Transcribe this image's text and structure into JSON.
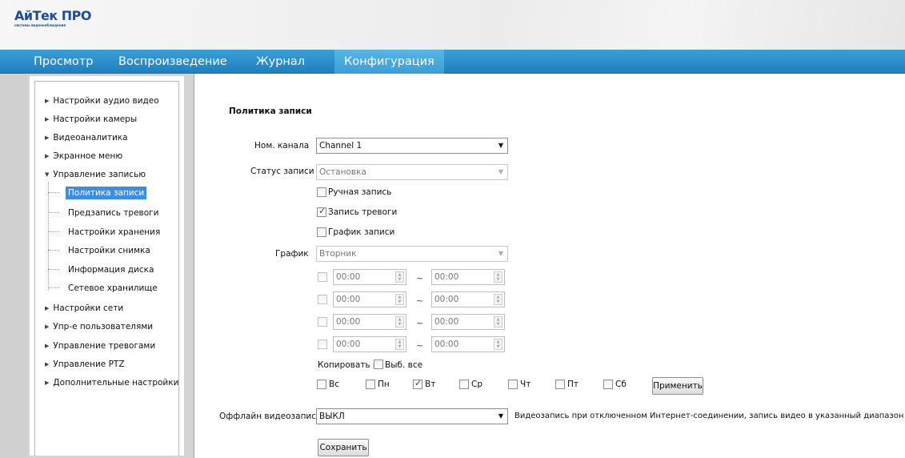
{
  "header": {
    "logo_main": "АйТек ПРО",
    "logo_sub": "системы видеонаблюдения"
  },
  "nav": {
    "tabs": [
      "Просмотр",
      "Воспроизведение",
      "Журнал",
      "Конфигурация"
    ],
    "active": "Конфигурация"
  },
  "sidebar": {
    "top_items": [
      "Настройки аудио видео",
      "Настройки камеры",
      "Видеоаналитика",
      "Экранное меню"
    ],
    "expanded_item": "Управление записью",
    "sub_items": [
      "Политика записи",
      "Предзапись тревоги",
      "Настройки хранения",
      "Настройки снимка",
      "Информация диска",
      "Сетевое хранилище"
    ],
    "active_sub": "Политика записи",
    "bottom_items": [
      "Настройки сети",
      "Упр-е пользователями",
      "Управление тревогами",
      "Управление PTZ",
      "Дополнительные настройки"
    ]
  },
  "form": {
    "title": "Политика записи",
    "channel_label": "Ном. канала",
    "channel_value": "Channel 1",
    "status_label": "Статус записи",
    "status_value": "Остановка",
    "manual_record": {
      "label": "Ручная запись",
      "checked": false
    },
    "alarm_record": {
      "label": "Запись тревоги",
      "checked": true
    },
    "schedule_record": {
      "label": "График записи",
      "checked": false
    },
    "schedule_label": "График",
    "schedule_day": "Вторник",
    "time_ranges": [
      {
        "start": "00:00",
        "end": "00:00"
      },
      {
        "start": "00:00",
        "end": "00:00"
      },
      {
        "start": "00:00",
        "end": "00:00"
      },
      {
        "start": "00:00",
        "end": "00:00"
      }
    ],
    "tilde": "~",
    "copy_label": "Копировать в",
    "select_all_label": "Выб. все",
    "days": [
      {
        "label": "Вс",
        "checked": false
      },
      {
        "label": "Пн",
        "checked": false
      },
      {
        "label": "Вт",
        "checked": true
      },
      {
        "label": "Ср",
        "checked": false
      },
      {
        "label": "Чт",
        "checked": false
      },
      {
        "label": "Пт",
        "checked": false
      },
      {
        "label": "Сб",
        "checked": false
      }
    ],
    "apply_label": "Применить",
    "offline_label": "Оффлайн видеозапись",
    "offline_value": "ВЫКЛ",
    "offline_hint": "Видеозапись при отключенном Интернет-соединении, запись видео в указанный диапазон времени",
    "save_label": "Сохранить"
  }
}
